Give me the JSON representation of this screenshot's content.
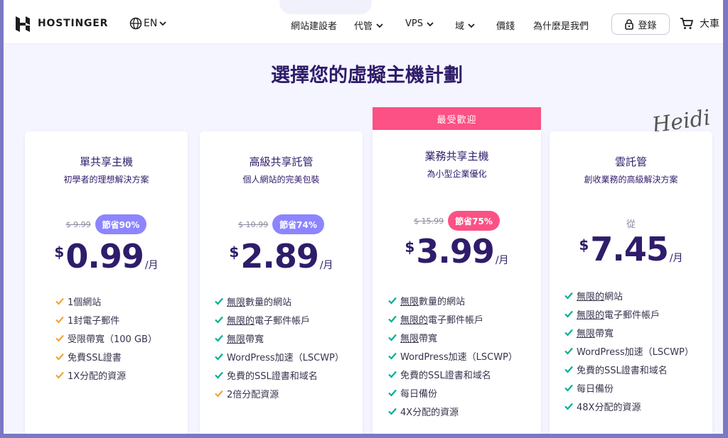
{
  "header": {
    "brand": "HOSTINGER",
    "language": "EN",
    "nav": [
      "網站建設者",
      "代管",
      "VPS",
      "域",
      "價錢",
      "為什麼是我們"
    ],
    "login": "登錄",
    "cart": "大車"
  },
  "page_title": "選擇您的虛擬主機計劃",
  "signature": "Heidi",
  "ribbon": "最受歡迎",
  "plans": [
    {
      "name": "單共享主機",
      "subtitle": "初學者的理想解決方案",
      "old_price": "$ 9.99",
      "savings": "節省90%",
      "currency": "$",
      "price": "0.99",
      "per": "/月",
      "features": [
        "1個網站",
        "1封電子郵件",
        "受限帶寬（100 GB）",
        "免費SSL證書",
        "1X分配的資源"
      ]
    },
    {
      "name": "高級共享託管",
      "subtitle": "個人網站的完美包裝",
      "old_price": "$ 10.99",
      "savings": "節省74%",
      "currency": "$",
      "price": "2.89",
      "per": "/月",
      "features": [
        {
          "u": "無限",
          "t": "數量的網站"
        },
        {
          "u": "無限的",
          "t": "電子郵件帳戶"
        },
        {
          "u": "無限",
          "t": "帶寬"
        },
        {
          "u": "",
          "t": "WordPress加速（LSCWP）"
        },
        {
          "u": "",
          "t": "免費的SSL證書和域名"
        },
        {
          "u": "",
          "t": "2倍分配資源"
        }
      ]
    },
    {
      "name": "業務共享主機",
      "subtitle": "為小型企業優化",
      "old_price": "$ 15.99",
      "savings": "節省75%",
      "currency": "$",
      "price": "3.99",
      "per": "/月",
      "features": [
        {
          "u": "無限",
          "t": "數量的網站"
        },
        {
          "u": "無限的",
          "t": "電子郵件帳戶"
        },
        {
          "u": "無限",
          "t": "帶寬"
        },
        {
          "u": "",
          "t": "WordPress加速（LSCWP）"
        },
        {
          "u": "",
          "t": "免費的SSL證書和域名"
        },
        {
          "u": "",
          "t": "每日備份"
        },
        {
          "u": "",
          "t": "4X分配的資源"
        }
      ]
    },
    {
      "name": "雲託管",
      "subtitle": "創收業務的高級解決方案",
      "from": "從",
      "currency": "$",
      "price": "7.45",
      "per": "/月",
      "features": [
        {
          "u": "無限的",
          "t": "網站"
        },
        {
          "u": "無限的",
          "t": "電子郵件帳戶"
        },
        {
          "u": "無限",
          "t": "帶寬"
        },
        {
          "u": "",
          "t": "WordPress加速（LSCWP）"
        },
        {
          "u": "",
          "t": "免費的SSL證書和域名"
        },
        {
          "u": "",
          "t": "每日備份"
        },
        {
          "u": "",
          "t": "48X分配的資源"
        }
      ]
    }
  ],
  "colors": {
    "brand_purple": "#2f1c6a",
    "badge_purple": "#8c85ff",
    "accent_pink": "#fc5185",
    "check_orange": "#f2a33a",
    "check_green": "#00b090"
  }
}
